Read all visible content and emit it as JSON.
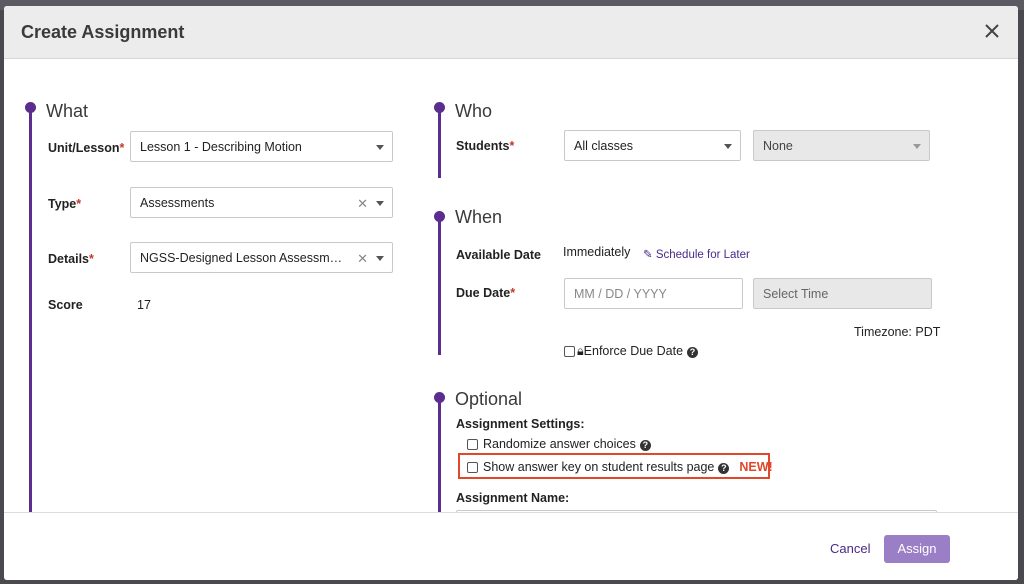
{
  "modal": {
    "title": "Create Assignment"
  },
  "what": {
    "title": "What",
    "unit_label": "Unit/Lesson",
    "unit_value": "Lesson 1 - Describing Motion",
    "type_label": "Type",
    "type_value": "Assessments",
    "details_label": "Details",
    "details_value": "NGSS-Designed Lesson Assessment: ...",
    "score_label": "Score",
    "score_value": "17"
  },
  "who": {
    "title": "Who",
    "students_label": "Students",
    "students_value": "All classes",
    "secondary_value": "None"
  },
  "when": {
    "title": "When",
    "available_label": "Available Date",
    "available_value": "Immediately",
    "schedule_link": "Schedule for Later",
    "due_label": "Due Date",
    "date_placeholder": "MM / DD / YYYY",
    "time_placeholder": "Select Time",
    "timezone": "Timezone: PDT",
    "enforce_label": "Enforce Due Date"
  },
  "optional": {
    "title": "Optional",
    "settings_label": "Assignment Settings:",
    "randomize_label": "Randomize answer choices",
    "show_key_label": "Show answer key on student results page",
    "new_badge": "NEW!",
    "name_label": "Assignment Name:"
  },
  "footer": {
    "cancel": "Cancel",
    "assign": "Assign"
  },
  "colors": {
    "accent": "#5b2d8e",
    "highlight": "#e0472b",
    "assign_button": "#9a7fc6"
  },
  "icons": {
    "close": "close-icon",
    "schedule": "edit-icon",
    "lock": "lock-icon",
    "help": "help-icon"
  }
}
